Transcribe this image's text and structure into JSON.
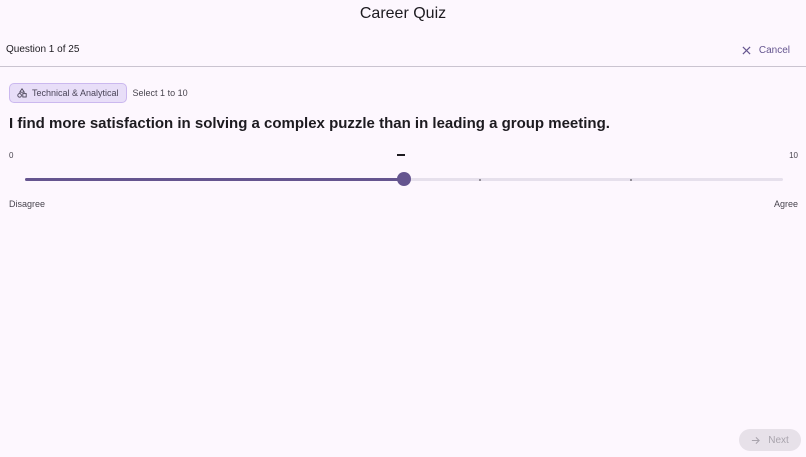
{
  "header": {
    "title": "Career Quiz"
  },
  "progress": {
    "question_count": "Question 1 of 25",
    "cancel_label": "Cancel"
  },
  "question": {
    "category": "Technical & Analytical",
    "range_hint": "Select 1 to 10",
    "text": "I find more satisfaction in solving a complex puzzle than in leading a group meeting."
  },
  "slider": {
    "min_label": "0",
    "max_label": "10",
    "value": 5,
    "min": 0,
    "max": 10,
    "left_label": "Disagree",
    "right_label": "Agree"
  },
  "footer": {
    "next_label": "Next"
  },
  "colors": {
    "accent": "#65558f",
    "chip_bg": "#e8def8",
    "background": "#fdf7fe"
  },
  "icons": {
    "cancel": "close-icon",
    "category": "shapes-icon",
    "next": "arrow-right-icon"
  }
}
